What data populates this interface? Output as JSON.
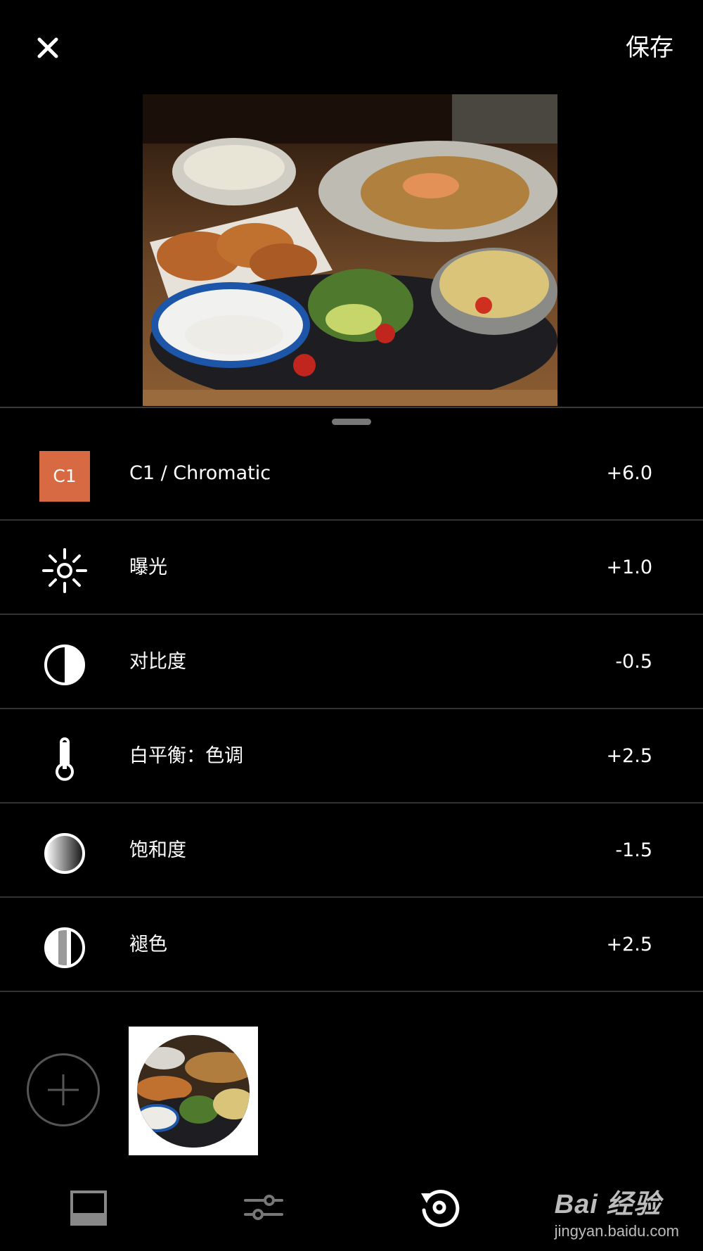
{
  "header": {
    "close_icon": "close-icon",
    "save_label": "保存"
  },
  "photo": {
    "description_icon": "food-photo"
  },
  "adjustments": [
    {
      "id": "c1-chromatic",
      "badge": "C1",
      "label": "C1 / Chromatic",
      "value": "+6.0",
      "badge_color": "#d86a43"
    },
    {
      "id": "exposure",
      "icon": "sun-icon",
      "label": "曝光",
      "value": "+1.0"
    },
    {
      "id": "contrast",
      "icon": "contrast-icon",
      "label": "对比度",
      "value": "-0.5"
    },
    {
      "id": "white-balance-tint",
      "icon": "thermometer-icon",
      "label": "白平衡：色调",
      "value": "+2.5"
    },
    {
      "id": "saturation",
      "icon": "saturation-icon",
      "label": "饱和度",
      "value": "-1.5"
    },
    {
      "id": "fade",
      "icon": "fade-icon",
      "label": "褪色",
      "value": "+2.5"
    }
  ],
  "bottom_tabs": [
    {
      "id": "filters",
      "icon": "filter-frame-icon"
    },
    {
      "id": "tools",
      "icon": "sliders-icon"
    },
    {
      "id": "history",
      "icon": "history-icon"
    }
  ],
  "watermark": {
    "brand": "Bai 经验",
    "url": "jingyan.baidu.com"
  }
}
